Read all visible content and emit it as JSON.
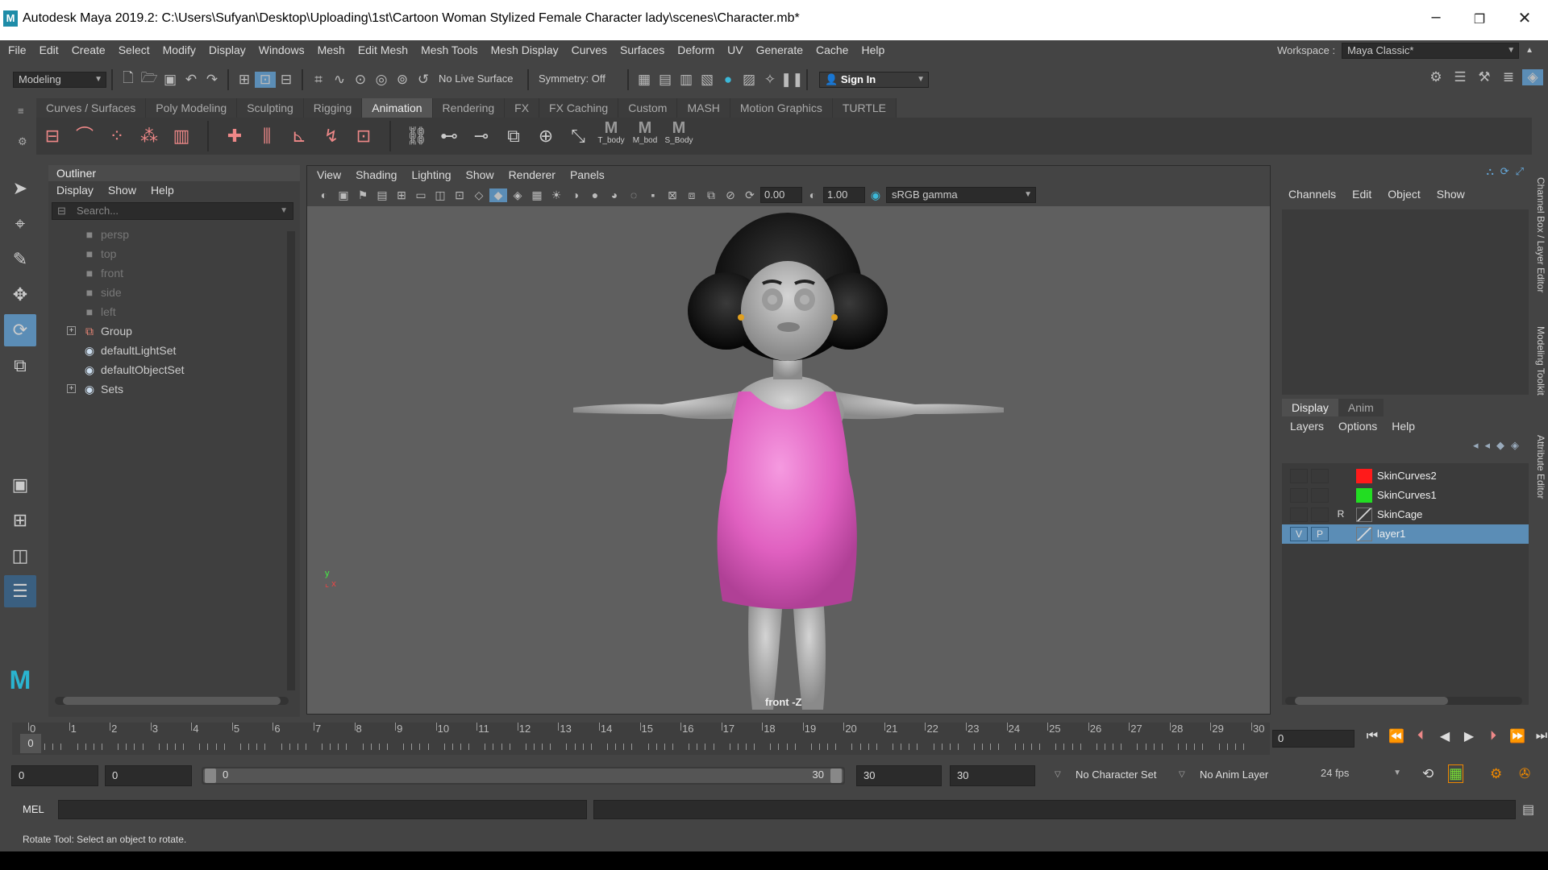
{
  "title": "Autodesk Maya 2019.2: C:\\Users\\Sufyan\\Desktop\\Uploading\\1st\\Cartoon Woman Stylized Female Character lady\\scenes\\Character.mb*",
  "menus": [
    "File",
    "Edit",
    "Create",
    "Select",
    "Modify",
    "Display",
    "Windows",
    "Mesh",
    "Edit Mesh",
    "Mesh Tools",
    "Mesh Display",
    "Curves",
    "Surfaces",
    "Deform",
    "UV",
    "Generate",
    "Cache",
    "Help"
  ],
  "workspace": {
    "label": "Workspace :",
    "value": "Maya Classic*"
  },
  "status": {
    "mode": "Modeling",
    "live_surface": "No Live Surface",
    "symmetry": "Symmetry: Off",
    "signin": "Sign In"
  },
  "shelf_tabs": [
    "Curves / Surfaces",
    "Poly Modeling",
    "Sculpting",
    "Rigging",
    "Animation",
    "Rendering",
    "FX",
    "FX Caching",
    "Custom",
    "MASH",
    "Motion Graphics",
    "TURTLE"
  ],
  "shelf_active": "Animation",
  "shelf_custom": [
    "T_body",
    "M_bod",
    "S_Body"
  ],
  "outliner": {
    "title": "Outliner",
    "menu": [
      "Display",
      "Show",
      "Help"
    ],
    "search_placeholder": "Search...",
    "items": [
      {
        "label": "persp",
        "type": "camera"
      },
      {
        "label": "top",
        "type": "camera"
      },
      {
        "label": "front",
        "type": "camera"
      },
      {
        "label": "side",
        "type": "camera"
      },
      {
        "label": "left",
        "type": "camera"
      },
      {
        "label": "Group",
        "type": "group"
      },
      {
        "label": "defaultLightSet",
        "type": "set"
      },
      {
        "label": "defaultObjectSet",
        "type": "set"
      },
      {
        "label": "Sets",
        "type": "set"
      }
    ]
  },
  "viewport": {
    "menu": [
      "View",
      "Shading",
      "Lighting",
      "Show",
      "Renderer",
      "Panels"
    ],
    "exposure": "0.00",
    "gamma": "1.00",
    "colorspace": "sRGB gamma",
    "camera_label": "front -Z"
  },
  "channelbox": {
    "menu": [
      "Channels",
      "Edit",
      "Object",
      "Show"
    ],
    "layer_tabs": [
      "Display",
      "Anim"
    ],
    "layer_menu": [
      "Layers",
      "Options",
      "Help"
    ],
    "layers": [
      {
        "v": "",
        "p": "",
        "r": "",
        "name": "SkinCurves2",
        "color": "#ff1a1a"
      },
      {
        "v": "",
        "p": "",
        "r": "",
        "name": "SkinCurves1",
        "color": "#22dd22"
      },
      {
        "v": "",
        "p": "",
        "r": "R",
        "name": "SkinCage",
        "color": "none"
      },
      {
        "v": "V",
        "p": "P",
        "r": "",
        "name": "layer1",
        "color": "none"
      }
    ]
  },
  "side_tabs": [
    "Channel Box / Layer Editor",
    "Modeling Toolkit",
    "Attribute Editor"
  ],
  "timeline": {
    "ticks": [
      "0",
      "1",
      "2",
      "3",
      "4",
      "5",
      "6",
      "7",
      "8",
      "9",
      "10",
      "11",
      "12",
      "13",
      "14",
      "15",
      "16",
      "17",
      "18",
      "19",
      "20",
      "21",
      "22",
      "23",
      "24",
      "25",
      "26",
      "27",
      "28",
      "29",
      "30"
    ],
    "current": "0",
    "current_field": "0"
  },
  "range": {
    "start": "0",
    "anim_start": "0",
    "slider_start": "0",
    "slider_end": "30",
    "end": "30",
    "anim_end": "30",
    "char_set": "No Character Set",
    "anim_layer": "No Anim Layer",
    "fps": "24 fps"
  },
  "cmd": {
    "label": "MEL"
  },
  "help": "Rotate Tool: Select an object to rotate.",
  "colors": {
    "accent": "#5b8db6",
    "dress": "#e060c0",
    "skin": "#b8b8b8",
    "hair": "#111111"
  }
}
